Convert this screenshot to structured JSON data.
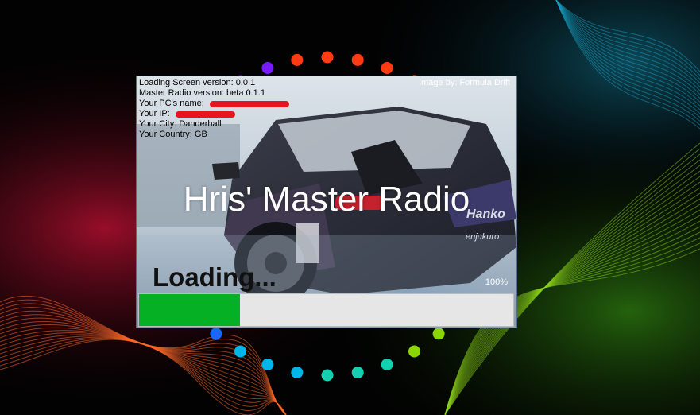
{
  "desktop": {
    "ring_colors": [
      "#ff3b14",
      "#ff7a00",
      "#ffc400",
      "#ffe500",
      "#8ad700",
      "#14d0b0",
      "#00b6e8",
      "#1a66ff",
      "#1e2fff",
      "#3b1aff",
      "#7a1aff"
    ]
  },
  "splash": {
    "info_lines": [
      {
        "label": "Loading Screen version: 0.0.1"
      },
      {
        "label": "Master Radio version: beta 0.1.1"
      },
      {
        "label": "Your PC's name: ",
        "redacted": true
      },
      {
        "label": "Your IP: ",
        "redacted": true
      },
      {
        "label": "Your City: Danderhall"
      },
      {
        "label": "Your Country: GB"
      }
    ],
    "image_credit": "Image by: Formula Drift",
    "title": "Hris' Master Radio",
    "loading_text": "Loading...",
    "percent_text": "100%",
    "progress_fraction": 0.27,
    "colors": {
      "progress_fill": "#06b025",
      "progress_track": "#e6e6e6",
      "redaction": "#e8141e"
    },
    "car_decals": [
      "Hanko",
      "enjukuro"
    ]
  }
}
